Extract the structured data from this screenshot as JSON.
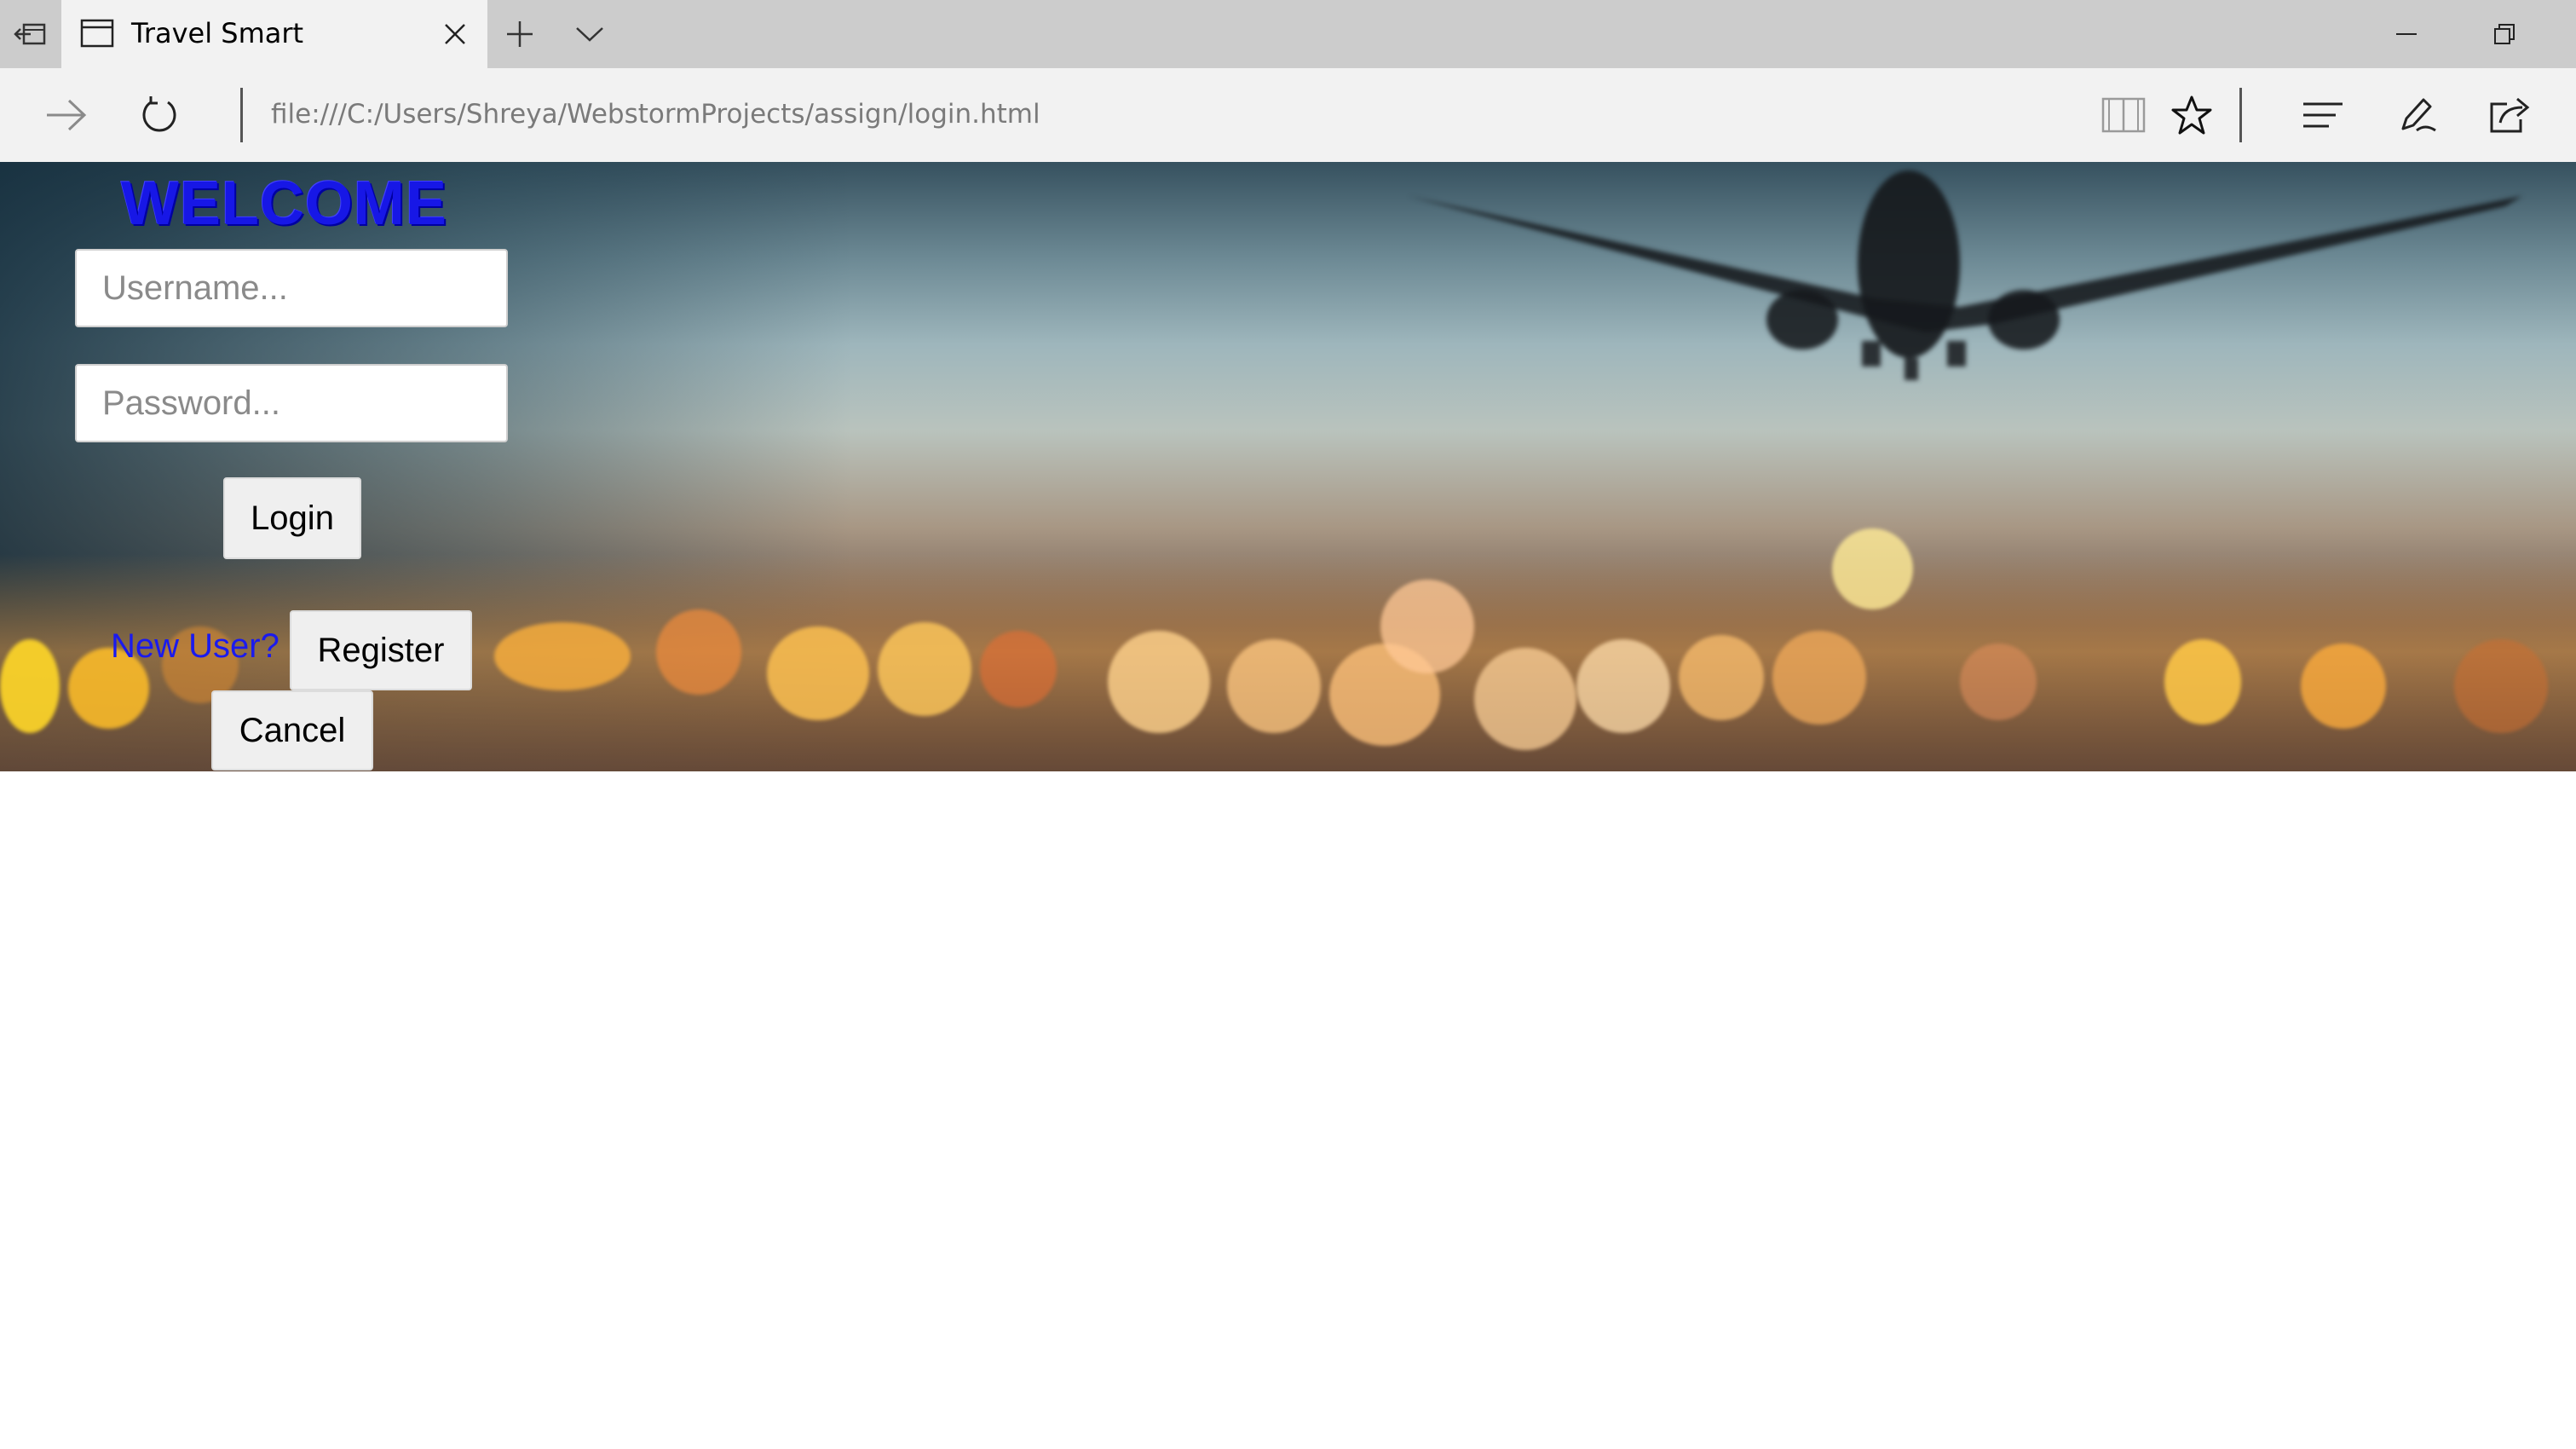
{
  "browser": {
    "tab": {
      "title": "Travel Smart"
    },
    "address": {
      "url": "file:///C:/Users/Shreya/WebstormProjects/assign/login.html"
    },
    "icons": {
      "set_aside": "tabs-aside-icon",
      "tab_page": "page-icon",
      "close": "close-icon",
      "new_tab": "plus-icon",
      "tab_list": "chevron-down-icon",
      "minimize": "minimize-icon",
      "restore": "restore-icon",
      "forward": "forward-arrow-icon",
      "refresh": "refresh-icon",
      "reading_view": "book-icon",
      "favorite": "star-icon",
      "hub": "hub-icon",
      "notes": "pen-icon",
      "share": "share-icon"
    }
  },
  "login": {
    "heading": "WELCOME",
    "username": {
      "placeholder": "Username...",
      "value": ""
    },
    "password": {
      "placeholder": "Password...",
      "value": ""
    },
    "login_label": "Login",
    "new_user_text": "New User?",
    "register_label": "Register",
    "cancel_label": "Cancel"
  },
  "colors": {
    "heading": "#1717e6",
    "link_text": "#1a1aee",
    "button_bg": "#efefef",
    "chrome_bg": "#cccccc",
    "toolbar_bg": "#f2f2f2"
  }
}
